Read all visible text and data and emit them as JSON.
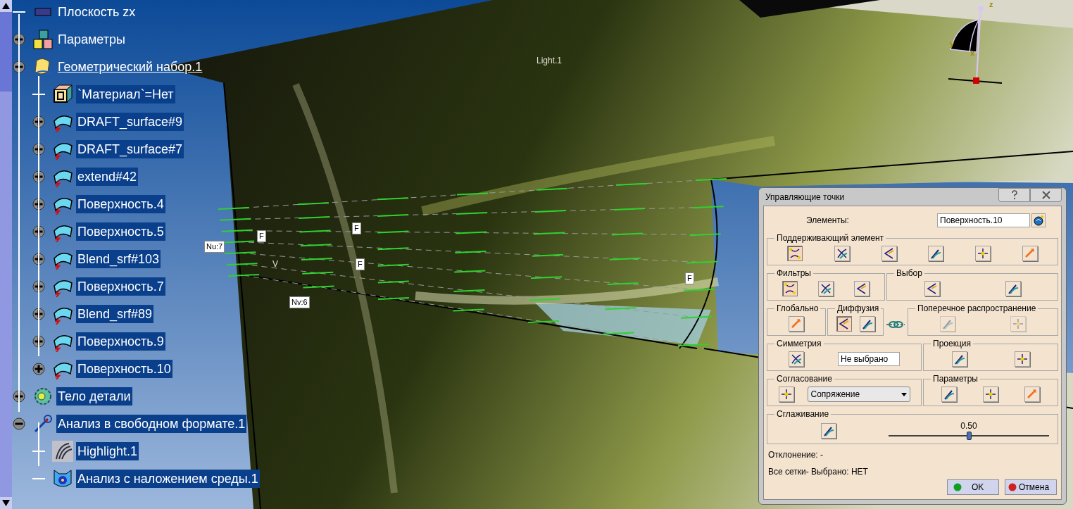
{
  "tree": [
    {
      "label": "Плоскость zx",
      "kind": "plane",
      "selected": false
    },
    {
      "label": "Параметры",
      "kind": "params",
      "selected": false,
      "expanded": false
    },
    {
      "label": "Геометрический набор.1",
      "kind": "geoset",
      "selected": false,
      "underlined": true,
      "expanded": true,
      "children": [
        {
          "label": "`Материал`=Нет",
          "kind": "material",
          "selected": true
        },
        {
          "label": "DRAFT_surface#9",
          "kind": "surface",
          "selected": true,
          "expanded": false
        },
        {
          "label": "DRAFT_surface#7",
          "kind": "surface",
          "selected": true,
          "expanded": false
        },
        {
          "label": "extend#42",
          "kind": "surface",
          "selected": true,
          "expanded": false
        },
        {
          "label": "Поверхность.4",
          "kind": "surface",
          "selected": true,
          "expanded": false
        },
        {
          "label": "Поверхность.5",
          "kind": "surface",
          "selected": true,
          "expanded": false
        },
        {
          "label": "Blend_srf#103",
          "kind": "surface",
          "selected": true,
          "expanded": false
        },
        {
          "label": "Поверхность.7",
          "kind": "surface",
          "selected": true,
          "expanded": false
        },
        {
          "label": "Blend_srf#89",
          "kind": "surface",
          "selected": true,
          "expanded": false
        },
        {
          "label": "Поверхность.9",
          "kind": "surface",
          "selected": true,
          "expanded": false
        },
        {
          "label": "Поверхность.10",
          "kind": "surface",
          "selected": true,
          "expanded": false
        }
      ]
    },
    {
      "label": "Тело детали",
      "kind": "body",
      "selected": true,
      "expanded": false
    },
    {
      "label": "Анализ в свободном формате.1",
      "kind": "analysis",
      "selected": true,
      "expanded": true,
      "children": [
        {
          "label": "Highlight.1",
          "kind": "highlight",
          "selected": true
        },
        {
          "label": "Анализ с наложением среды.1",
          "kind": "environment",
          "selected": true
        }
      ]
    }
  ],
  "viewport": {
    "labels": [
      {
        "text": "Light.1",
        "kind": "plain"
      },
      {
        "text": "Nu:7",
        "kind": "tag"
      },
      {
        "text": "Nv:6",
        "kind": "tag"
      },
      {
        "text": "F",
        "kind": "tag"
      },
      {
        "text": "F",
        "kind": "tag"
      },
      {
        "text": "F",
        "kind": "tag"
      },
      {
        "text": "F",
        "kind": "tag"
      },
      {
        "text": "V",
        "kind": "plain"
      }
    ],
    "compass": {
      "axes": [
        "z",
        "y",
        "x"
      ]
    }
  },
  "dialog": {
    "title": "Управляющие точки",
    "elements_label": "Элементы:",
    "elements_value": "Поверхность.10",
    "support": {
      "title": "Поддерживающий элемент",
      "buttons": [
        {
          "pressed": true
        },
        {
          "pressed": false
        },
        {
          "pressed": false
        },
        {
          "pressed": false
        },
        {
          "pressed": false
        },
        {
          "pressed": false
        }
      ]
    },
    "filters": {
      "title": "Фильтры",
      "buttons": [
        {
          "pressed": true
        },
        {
          "pressed": false
        },
        {
          "pressed": false
        }
      ]
    },
    "selection": {
      "title": "Выбор",
      "buttons": [
        {
          "pressed": false
        },
        {
          "pressed": false
        }
      ]
    },
    "global": {
      "title": "Глобально",
      "buttons": [
        {
          "pressed": false
        }
      ]
    },
    "diffusion": {
      "title": "Диффузия",
      "buttons": [
        {
          "pressed": true
        },
        {
          "pressed": false
        }
      ]
    },
    "transverse": {
      "title": "Поперечное распространение",
      "disabled": true,
      "buttons": [
        {
          "pressed": false
        },
        {
          "pressed": false
        }
      ]
    },
    "symmetry": {
      "title": "Симметрия",
      "value": "Не выбрано"
    },
    "projection": {
      "title": "Проекция",
      "buttons": [
        {
          "pressed": false
        },
        {
          "pressed": false
        }
      ]
    },
    "matching": {
      "title": "Согласование",
      "value": "Сопряжение"
    },
    "parameters": {
      "title": "Параметры",
      "buttons": [
        {
          "pressed": false
        },
        {
          "pressed": false
        },
        {
          "pressed": false
        }
      ]
    },
    "smoothing": {
      "title": "Сглаживание",
      "reading": "0.50",
      "level": 0.5
    },
    "deviation": "Отклонение: -",
    "meshes": "Все сетки- Выбрано: НЕТ",
    "ok": "OK",
    "cancel": "Отмена"
  }
}
